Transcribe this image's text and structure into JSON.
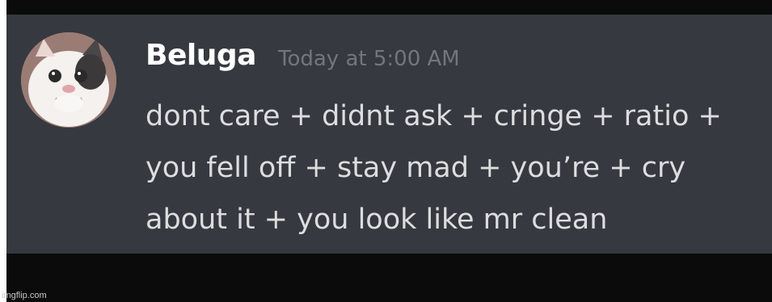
{
  "message": {
    "author": "Beluga",
    "timestamp": "Today at 5:00 AM",
    "lines": [
      "dont care + didnt ask + cringe + ratio +",
      "you fell off + stay mad + you’re + cry",
      "about it + you look like mr clean"
    ]
  },
  "avatar": {
    "icon": "cat-avatar-icon"
  },
  "watermark": "imgflip.com",
  "colors": {
    "panel_background": "#36393f",
    "outer_frame": "#0b0b0c",
    "username": "#ffffff",
    "timestamp": "#72767d",
    "message_text": "#dcddde"
  }
}
